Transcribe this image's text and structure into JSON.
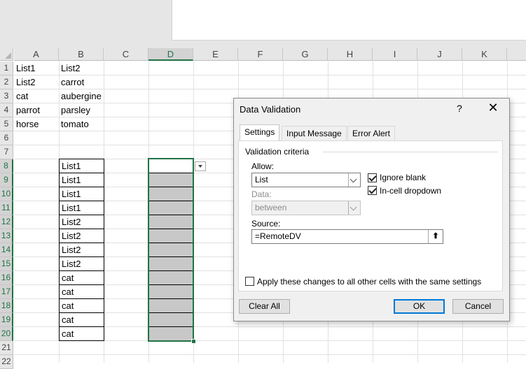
{
  "columns": [
    "A",
    "B",
    "C",
    "D",
    "E",
    "F",
    "G",
    "H",
    "I",
    "J",
    "K"
  ],
  "rows": [
    "1",
    "2",
    "3",
    "4",
    "5",
    "6",
    "7",
    "8",
    "9",
    "10",
    "11",
    "12",
    "13",
    "14",
    "15",
    "16",
    "17",
    "18",
    "19",
    "20",
    "21",
    "22"
  ],
  "cells": {
    "a": [
      "List1",
      "List2",
      "cat",
      "parrot",
      "horse"
    ],
    "b_top": [
      "List2",
      "carrot",
      "aubergine",
      "parsley",
      "tomato"
    ],
    "b_list": [
      "List1",
      "List1",
      "List1",
      "List1",
      "List2",
      "List2",
      "List2",
      "List2",
      "cat",
      "cat",
      "cat",
      "cat",
      "cat"
    ]
  },
  "dialog": {
    "title": "Data Validation",
    "help": "?",
    "close": "✕",
    "tabs": [
      "Settings",
      "Input Message",
      "Error Alert"
    ],
    "group_label": "Validation criteria",
    "allow_label": "Allow:",
    "allow_value": "List",
    "data_label": "Data:",
    "data_value": "between",
    "ignore_blank": "Ignore blank",
    "in_cell_dropdown": "In-cell dropdown",
    "ignore_blank_checked": true,
    "in_cell_dropdown_checked": true,
    "source_label": "Source:",
    "source_value": "=RemoteDV",
    "apply_all": "Apply these changes to all other cells with the same settings",
    "clear_all": "Clear All",
    "ok": "OK",
    "cancel": "Cancel"
  },
  "colors": {
    "accent": "#217346",
    "default_button": "#0078d7",
    "selected_fill": "#c8c8c8"
  },
  "icons": {
    "collapse": "upload-arrow-icon"
  }
}
